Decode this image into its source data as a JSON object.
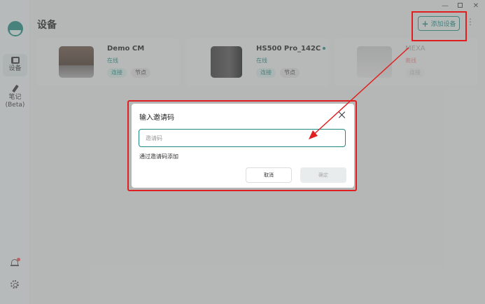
{
  "window": {
    "min": "—",
    "close": "✕"
  },
  "sidebar": {
    "items": [
      {
        "label": "设备"
      },
      {
        "label": "笔记\n(Beta)"
      }
    ]
  },
  "header": {
    "title": "设备",
    "add_button": "添加设备"
  },
  "devices": [
    {
      "name": "Demo CM",
      "status": "在线",
      "connect": "连接",
      "node": "节点"
    },
    {
      "name": "HS500 Pro_142C",
      "status": "在线",
      "connect": "连接",
      "node": "节点"
    },
    {
      "name": "MEXA",
      "status": "离线",
      "connect": "连接"
    }
  ],
  "dialog": {
    "title": "输入邀请码",
    "input_placeholder": "邀请码",
    "input_value": "",
    "hint": "通过邀请码添加",
    "cancel": "取消",
    "confirm": "确定"
  },
  "colors": {
    "accent": "#1f8a82",
    "highlight": "#e02020"
  }
}
